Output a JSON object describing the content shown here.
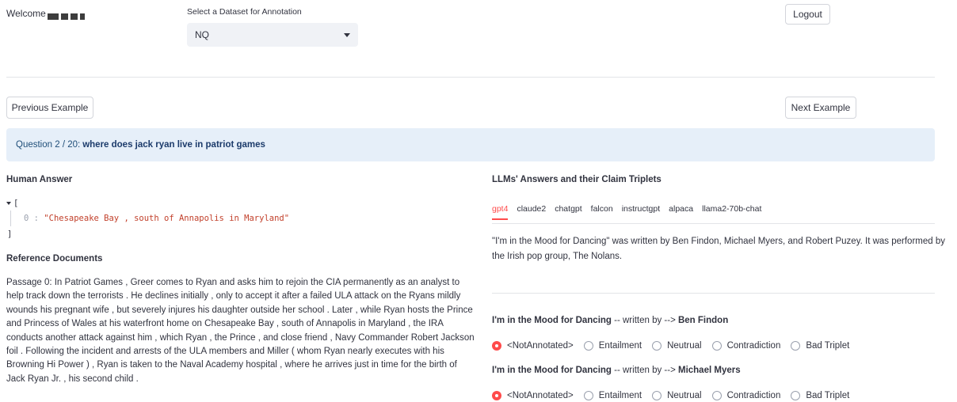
{
  "header": {
    "welcome": "Welcome",
    "dataset_label": "Select a Dataset for Annotation",
    "dataset_selected": "NQ",
    "logout": "Logout"
  },
  "nav": {
    "previous": "Previous Example",
    "next": "Next Example"
  },
  "question": {
    "prefix": "Question 2 / 20:",
    "text": "where does jack ryan live in patriot games"
  },
  "human_answer": {
    "title": "Human Answer",
    "open_bracket": "[",
    "close_bracket": "]",
    "items": [
      {
        "index": "0",
        "sep": " : ",
        "value": "\"Chesapeake Bay , south of Annapolis in Maryland\""
      }
    ]
  },
  "reference": {
    "title": "Reference Documents",
    "passage": "Passage 0: In Patriot Games , Greer comes to Ryan and asks him to rejoin the CIA permanently as an analyst to help track down the terrorists . He declines initially , only to accept it after a failed ULA attack on the Ryans mildly wounds his pregnant wife , but severely injures his daughter outside her school . Later , while Ryan hosts the Prince and Princess of Wales at his waterfront home on Chesapeake Bay , south of Annapolis in Maryland , the IRA conducts another attack against him , which Ryan , the Prince , and close friend , Navy Commander Robert Jackson foil . Following the incident and arrests of the ULA members and Miller ( whom Ryan nearly executes with his Browning Hi Power ) , Ryan is taken to the Naval Academy hospital , where he arrives just in time for the birth of Jack Ryan Jr. , his second child ."
  },
  "llm": {
    "title": "LLMs' Answers and their Claim Triplets",
    "tabs": [
      "gpt4",
      "claude2",
      "chatgpt",
      "falcon",
      "instructgpt",
      "alpaca",
      "llama2-70b-chat"
    ],
    "active_tab": "gpt4",
    "answer": "\"I'm in the Mood for Dancing\" was written by Ben Findon, Michael Myers, and Robert Puzey. It was performed by the Irish pop group, The Nolans."
  },
  "triplets": [
    {
      "subject": "I'm in the Mood for Dancing",
      "relation": " -- written by --> ",
      "object": "Ben Findon"
    },
    {
      "subject": "I'm in the Mood for Dancing",
      "relation": " -- written by --> ",
      "object": "Michael Myers"
    }
  ],
  "radio_options": [
    "<NotAnnotated>",
    "Entailment",
    "Neutrual",
    "Contradiction",
    "Bad Triplet"
  ],
  "radio_selected": "<NotAnnotated>",
  "colors": {
    "accent": "#ff4b4b",
    "info_bg": "#e6eff9",
    "json_string": "#c2402b"
  }
}
